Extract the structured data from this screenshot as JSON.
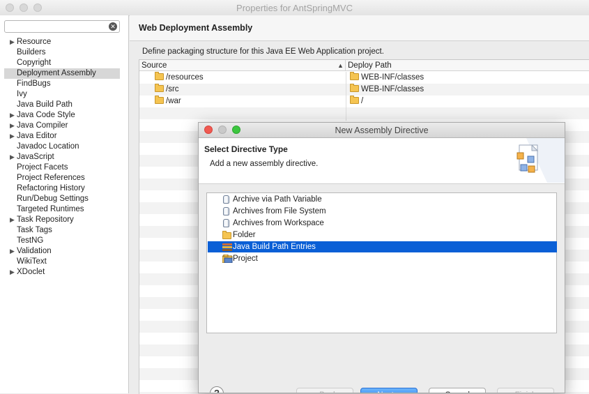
{
  "window": {
    "title": "Properties for AntSpringMVC"
  },
  "filter": {
    "value": "",
    "placeholder": ""
  },
  "nav": {
    "items": [
      {
        "label": "Resource",
        "expandable": true,
        "selected": false
      },
      {
        "label": "Builders",
        "expandable": false,
        "selected": false
      },
      {
        "label": "Copyright",
        "expandable": false,
        "selected": false
      },
      {
        "label": "Deployment Assembly",
        "expandable": false,
        "selected": true
      },
      {
        "label": "FindBugs",
        "expandable": false,
        "selected": false
      },
      {
        "label": "Ivy",
        "expandable": false,
        "selected": false
      },
      {
        "label": "Java Build Path",
        "expandable": false,
        "selected": false
      },
      {
        "label": "Java Code Style",
        "expandable": true,
        "selected": false
      },
      {
        "label": "Java Compiler",
        "expandable": true,
        "selected": false
      },
      {
        "label": "Java Editor",
        "expandable": true,
        "selected": false
      },
      {
        "label": "Javadoc Location",
        "expandable": false,
        "selected": false
      },
      {
        "label": "JavaScript",
        "expandable": true,
        "selected": false
      },
      {
        "label": "Project Facets",
        "expandable": false,
        "selected": false
      },
      {
        "label": "Project References",
        "expandable": false,
        "selected": false
      },
      {
        "label": "Refactoring History",
        "expandable": false,
        "selected": false
      },
      {
        "label": "Run/Debug Settings",
        "expandable": false,
        "selected": false
      },
      {
        "label": "Targeted Runtimes",
        "expandable": false,
        "selected": false
      },
      {
        "label": "Task Repository",
        "expandable": true,
        "selected": false
      },
      {
        "label": "Task Tags",
        "expandable": false,
        "selected": false
      },
      {
        "label": "TestNG",
        "expandable": false,
        "selected": false
      },
      {
        "label": "Validation",
        "expandable": true,
        "selected": false
      },
      {
        "label": "WikiText",
        "expandable": false,
        "selected": false
      },
      {
        "label": "XDoclet",
        "expandable": true,
        "selected": false
      }
    ]
  },
  "main": {
    "title": "Web Deployment Assembly",
    "description": "Define packaging structure for this Java EE Web Application project.",
    "table": {
      "columns": [
        "Source",
        "Deploy Path"
      ],
      "rows": [
        {
          "source": "/resources",
          "deploy": "WEB-INF/classes"
        },
        {
          "source": "/src",
          "deploy": "WEB-INF/classes"
        },
        {
          "source": "/war",
          "deploy": "/"
        }
      ]
    }
  },
  "dialog": {
    "title": "New Assembly Directive",
    "heading": "Select Directive Type",
    "subtitle": "Add a new assembly directive.",
    "items": [
      {
        "label": "Archive via Path Variable",
        "icon": "jar-icon",
        "selected": false
      },
      {
        "label": "Archives from File System",
        "icon": "jar-icon",
        "selected": false
      },
      {
        "label": "Archives from Workspace",
        "icon": "jar-icon",
        "selected": false
      },
      {
        "label": "Folder",
        "icon": "folder-icon",
        "selected": false
      },
      {
        "label": "Java Build Path Entries",
        "icon": "library-icon",
        "selected": true
      },
      {
        "label": "Project",
        "icon": "project-icon",
        "selected": false
      }
    ],
    "buttons": {
      "help": "?",
      "back": "< Back",
      "next": "Next >",
      "cancel": "Cancel",
      "finish": "Finish"
    }
  },
  "colors": {
    "selection": "#0a5fd6",
    "default_button": "#1d7af0",
    "close_dot": "#f05a52",
    "minimize_dot": "#c9c9c9",
    "zoom_dot": "#3cc63f"
  }
}
